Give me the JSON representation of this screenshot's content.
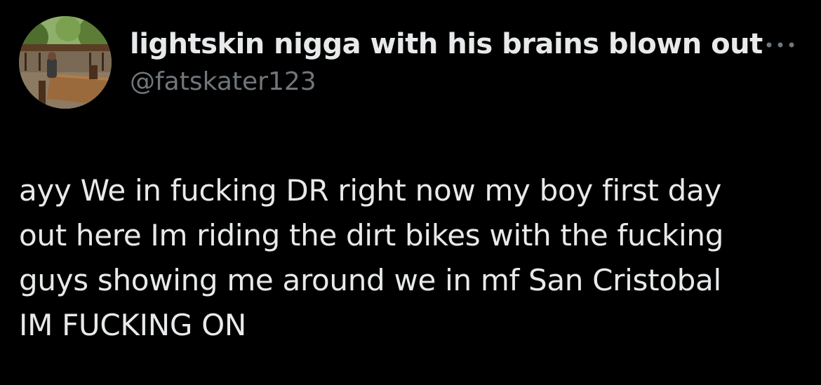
{
  "author": {
    "display_name": "lightskin nigga with his brains blown out",
    "handle": "@fatskater123",
    "avatar_icon": "avatar-photo-porch"
  },
  "menu": {
    "icon": "more-horizontal-icon"
  },
  "tweet": {
    "lines": [
      "ayy We in fucking DR right now my boy first day",
      "out here Im riding the dirt bikes with the fucking",
      "guys showing me around we in mf San Cristobal",
      "IM FUCKING ON"
    ]
  },
  "colors": {
    "background": "#000000",
    "primary_text": "#e7e9ea",
    "secondary_text": "#71767b"
  }
}
